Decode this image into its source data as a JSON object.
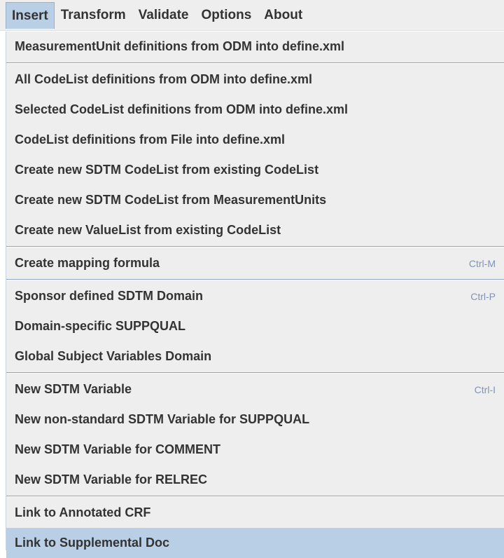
{
  "menubar": {
    "items": [
      {
        "label": "Insert"
      },
      {
        "label": "Transform"
      },
      {
        "label": "Validate"
      },
      {
        "label": "Options"
      },
      {
        "label": "About"
      }
    ]
  },
  "menu": {
    "groups": [
      {
        "items": [
          {
            "label": "MeasurementUnit definitions from ODM into define.xml",
            "accel": ""
          }
        ]
      },
      {
        "items": [
          {
            "label": "All CodeList definitions from ODM into define.xml",
            "accel": ""
          },
          {
            "label": "Selected CodeList definitions from ODM into define.xml",
            "accel": ""
          },
          {
            "label": "CodeList definitions from File into define.xml",
            "accel": ""
          },
          {
            "label": "Create new SDTM CodeList from existing CodeList",
            "accel": ""
          },
          {
            "label": "Create new SDTM CodeList from MeasurementUnits",
            "accel": ""
          },
          {
            "label": "Create new ValueList from existing CodeList",
            "accel": ""
          }
        ]
      },
      {
        "items": [
          {
            "label": "Create mapping formula",
            "accel": "Ctrl-M"
          }
        ]
      },
      {
        "items": [
          {
            "label": "Sponsor defined SDTM Domain",
            "accel": "Ctrl-P"
          },
          {
            "label": "Domain-specific SUPPQUAL",
            "accel": ""
          },
          {
            "label": "Global Subject Variables Domain",
            "accel": ""
          }
        ]
      },
      {
        "items": [
          {
            "label": "New SDTM Variable",
            "accel": "Ctrl-I"
          },
          {
            "label": "New non-standard SDTM Variable for SUPPQUAL",
            "accel": ""
          },
          {
            "label": "New SDTM Variable for COMMENT",
            "accel": ""
          },
          {
            "label": "New SDTM Variable for RELREC",
            "accel": ""
          }
        ]
      },
      {
        "items": [
          {
            "label": "Link to Annotated CRF",
            "accel": ""
          },
          {
            "label": "Link to Supplemental Doc",
            "accel": ""
          }
        ]
      }
    ]
  },
  "state": {
    "active_menu": "Insert",
    "highlighted_item": "Link to Supplemental Doc"
  },
  "colors": {
    "highlight": "#b8cfe5",
    "menu_background": "#eeeeee",
    "separator": "#8fa5c2",
    "accelerator_text": "#7f93b8",
    "text": "#333333"
  }
}
